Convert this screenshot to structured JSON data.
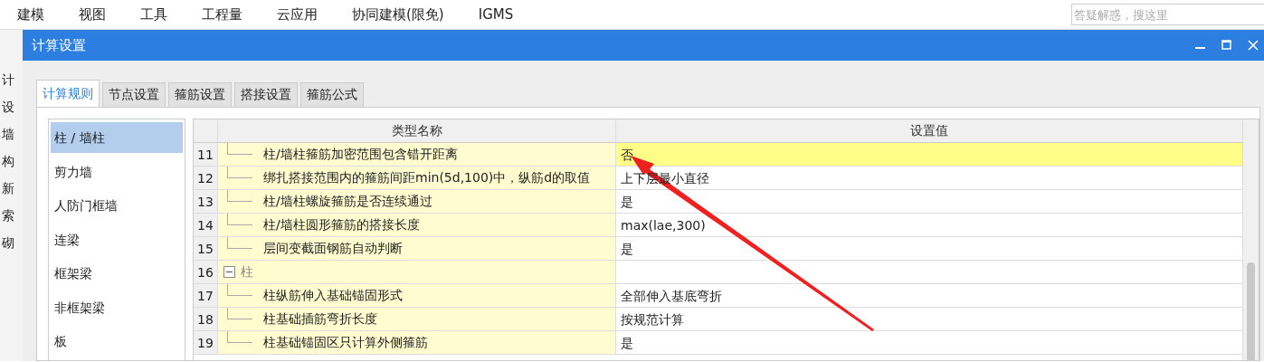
{
  "menu": [
    "建模",
    "视图",
    "工具",
    "工程量",
    "云应用",
    "协同建模(限免)",
    "IGMS"
  ],
  "search": {
    "placeholder": "答疑解惑，搜这里"
  },
  "background_panel": [
    "计",
    "设",
    "墙",
    "构",
    "新",
    "索",
    "砌"
  ],
  "dialog": {
    "title": "计算设置",
    "tabs": [
      {
        "label": "计算规则",
        "selected": true
      },
      {
        "label": "节点设置",
        "selected": false
      },
      {
        "label": "箍筋设置",
        "selected": false
      },
      {
        "label": "搭接设置",
        "selected": false
      },
      {
        "label": "箍筋公式",
        "selected": false
      }
    ],
    "categories": [
      {
        "label": "柱 / 墙柱",
        "selected": true
      },
      {
        "label": "剪力墙",
        "selected": false
      },
      {
        "label": "人防门框墙",
        "selected": false
      },
      {
        "label": "连梁",
        "selected": false
      },
      {
        "label": "框架梁",
        "selected": false
      },
      {
        "label": "非框架梁",
        "selected": false
      },
      {
        "label": "板",
        "selected": false
      }
    ],
    "table": {
      "columns": [
        "类型名称",
        "设置值"
      ],
      "rows": [
        {
          "kind": "item",
          "number": "11",
          "name": "柱/墙柱箍筋加密范围包含错开距离",
          "value": "否",
          "selected": true
        },
        {
          "kind": "item",
          "number": "12",
          "name": "绑扎搭接范围内的箍筋间距min(5d,100)中，纵筋d的取值",
          "value": "上下层最小直径",
          "selected": false
        },
        {
          "kind": "item",
          "number": "13",
          "name": "柱/墙柱螺旋箍筋是否连续通过",
          "value": "是",
          "selected": false
        },
        {
          "kind": "item",
          "number": "14",
          "name": "柱/墙柱圆形箍筋的搭接长度",
          "value": "max(lae,300)",
          "selected": false
        },
        {
          "kind": "item",
          "number": "15",
          "name": "层间变截面钢筋自动判断",
          "value": "是",
          "selected": false
        },
        {
          "kind": "group",
          "number": "16",
          "name": "柱",
          "expanded": true,
          "selected": false
        },
        {
          "kind": "item",
          "number": "17",
          "name": "柱纵筋伸入基础锚固形式",
          "value": "全部伸入基底弯折",
          "selected": false
        },
        {
          "kind": "item",
          "number": "18",
          "name": "柱基础插筋弯折长度",
          "value": "按规范计算",
          "selected": false
        },
        {
          "kind": "item",
          "number": "19",
          "name": "柱基础锚固区只计算外侧箍筋",
          "value": "是",
          "selected": false
        }
      ]
    }
  }
}
